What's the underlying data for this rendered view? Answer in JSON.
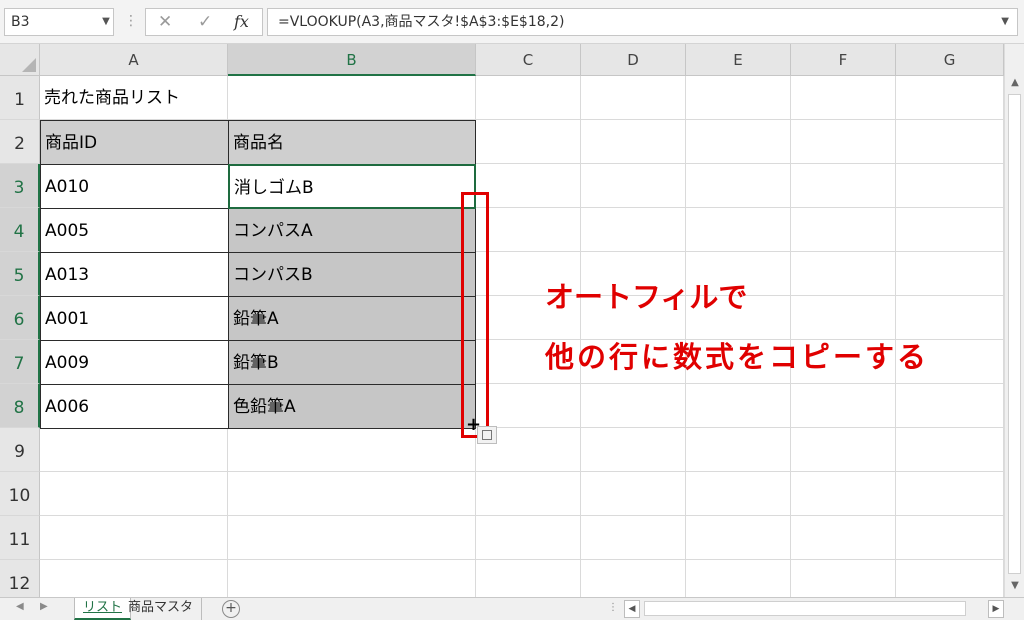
{
  "formula_bar": {
    "name_box": "B3",
    "name_box_arrow": "▼",
    "separator": "⋮",
    "cancel_icon": "✕",
    "enter_icon": "✓",
    "fx_icon": "fx",
    "formula": "=VLOOKUP(A3,商品マスタ!$A$3:$E$18,2)",
    "expand_icon": "▼"
  },
  "columns": [
    "A",
    "B",
    "C",
    "D",
    "E",
    "F",
    "G"
  ],
  "rows": [
    "1",
    "2",
    "3",
    "4",
    "5",
    "6",
    "7",
    "8",
    "9",
    "10",
    "11",
    "12"
  ],
  "cells": {
    "A1": "売れた商品リスト",
    "A2": "商品ID",
    "B2": "商品名",
    "A3": "A010",
    "B3": "消しゴムB",
    "A4": "A005",
    "B4": "コンパスA",
    "A5": "A013",
    "B5": "コンパスB",
    "A6": "A001",
    "B6": "鉛筆A",
    "A7": "A009",
    "B7": "鉛筆B",
    "A8": "A006",
    "B8": "色鉛筆A"
  },
  "fill_handle_icon": "+",
  "annotation": {
    "line1": "オートフィルで",
    "line2": "他の行に数式をコピーする",
    "color": "#e00000"
  },
  "scrollbar": {
    "up": "▲",
    "down": "▼",
    "left": "◀",
    "right": "▶"
  },
  "tabs": {
    "prev": "◀",
    "next": "▶",
    "items": [
      "リスト",
      "商品マスタ"
    ],
    "add_icon": "+",
    "splitter": "⋮"
  },
  "colors": {
    "accent": "#217346",
    "header_fill": "#cfcfcf",
    "fill_selection": "#c6c6c6"
  }
}
